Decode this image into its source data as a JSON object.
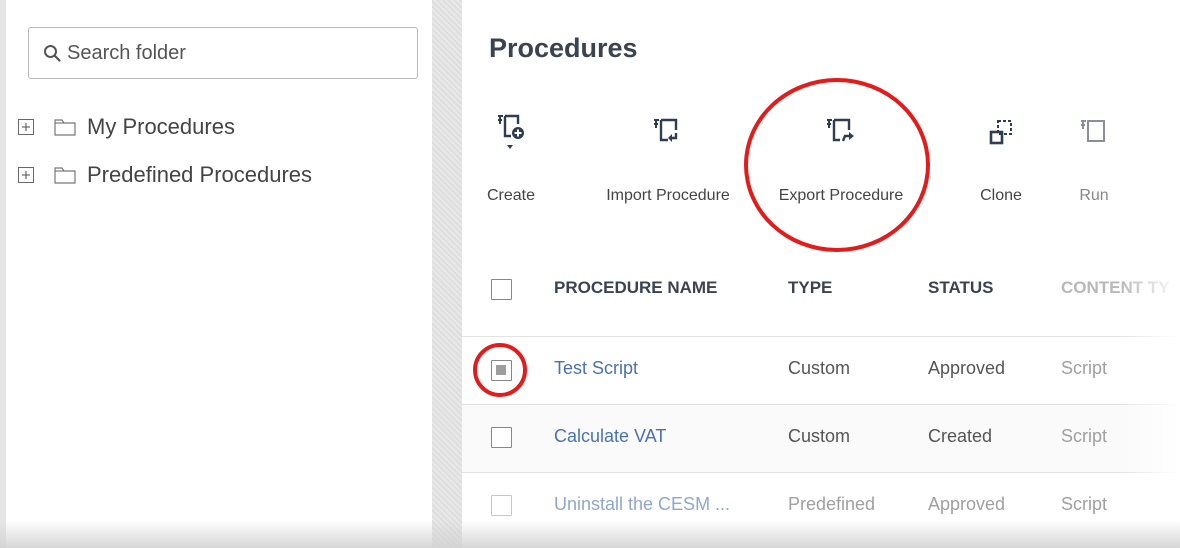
{
  "search": {
    "placeholder": "Search folder"
  },
  "tree": {
    "items": [
      {
        "label": "My Procedures"
      },
      {
        "label": "Predefined Procedures"
      }
    ]
  },
  "header": {
    "title": "Procedures"
  },
  "toolbar": {
    "create_label": "Create",
    "import_label": "Import Procedure",
    "export_label": "Export Procedure",
    "clone_label": "Clone",
    "run_label": "Run"
  },
  "table": {
    "columns": {
      "name": "PROCEDURE NAME",
      "type": "TYPE",
      "status": "STATUS",
      "content_type": "CONTENT TY"
    },
    "rows": [
      {
        "name": "Test Script",
        "type": "Custom",
        "status": "Approved",
        "content_type": "Script",
        "checked": true
      },
      {
        "name": "Calculate VAT",
        "type": "Custom",
        "status": "Created",
        "content_type": "Script",
        "checked": false
      },
      {
        "name": "Uninstall the CESM ...",
        "type": "Predefined",
        "status": "Approved",
        "content_type": "Script",
        "checked": false
      }
    ]
  },
  "colors": {
    "accent_link": "#4a72b3",
    "highlight_circle": "#e31b1b",
    "title": "#3b4350",
    "icon": "#2f3d52"
  }
}
